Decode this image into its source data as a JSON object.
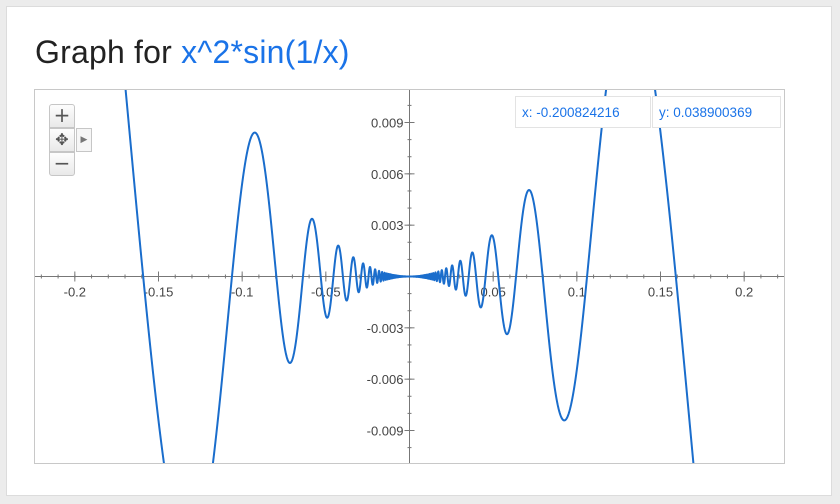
{
  "header": {
    "title_prefix": "Graph for",
    "function_text": "x^2*sin(1/x)"
  },
  "readout": {
    "x_text": "x: -0.200824216",
    "y_text": "y: 0.038900369"
  },
  "controls": {
    "zoom_in_icon": "plus-icon",
    "pan_icon": "move-arrows-icon",
    "pan_right_icon": "triangle-right-icon",
    "zoom_out_icon": "minus-icon"
  },
  "colors": {
    "curve": "#1a6dcc",
    "axis": "#777777",
    "tick_text": "#444444",
    "link_blue": "#1a73e8"
  },
  "chart_data": {
    "type": "line",
    "title": "Graph for x^2*sin(1/x)",
    "function": "x^2*sin(1/x)",
    "xlim": [
      -0.2238,
      0.2238
    ],
    "ylim": [
      -0.0109,
      0.0109
    ],
    "x_ticks": [
      -0.2,
      -0.15,
      -0.1,
      -0.05,
      0.05,
      0.1,
      0.15,
      0.2
    ],
    "x_tick_labels": [
      "-0.2",
      "-0.15",
      "-0.1",
      "-0.05",
      "0.05",
      "0.1",
      "0.15",
      "0.2"
    ],
    "y_ticks": [
      0.009,
      0.006,
      0.003,
      -0.003,
      -0.006,
      -0.009
    ],
    "y_tick_labels": [
      "0.009",
      "0.006",
      "0.003",
      "-0.003",
      "-0.006",
      "-0.009"
    ],
    "grid": false,
    "series": [
      {
        "expression": "x^2*sin(1/x)",
        "samples": 6000
      }
    ]
  }
}
